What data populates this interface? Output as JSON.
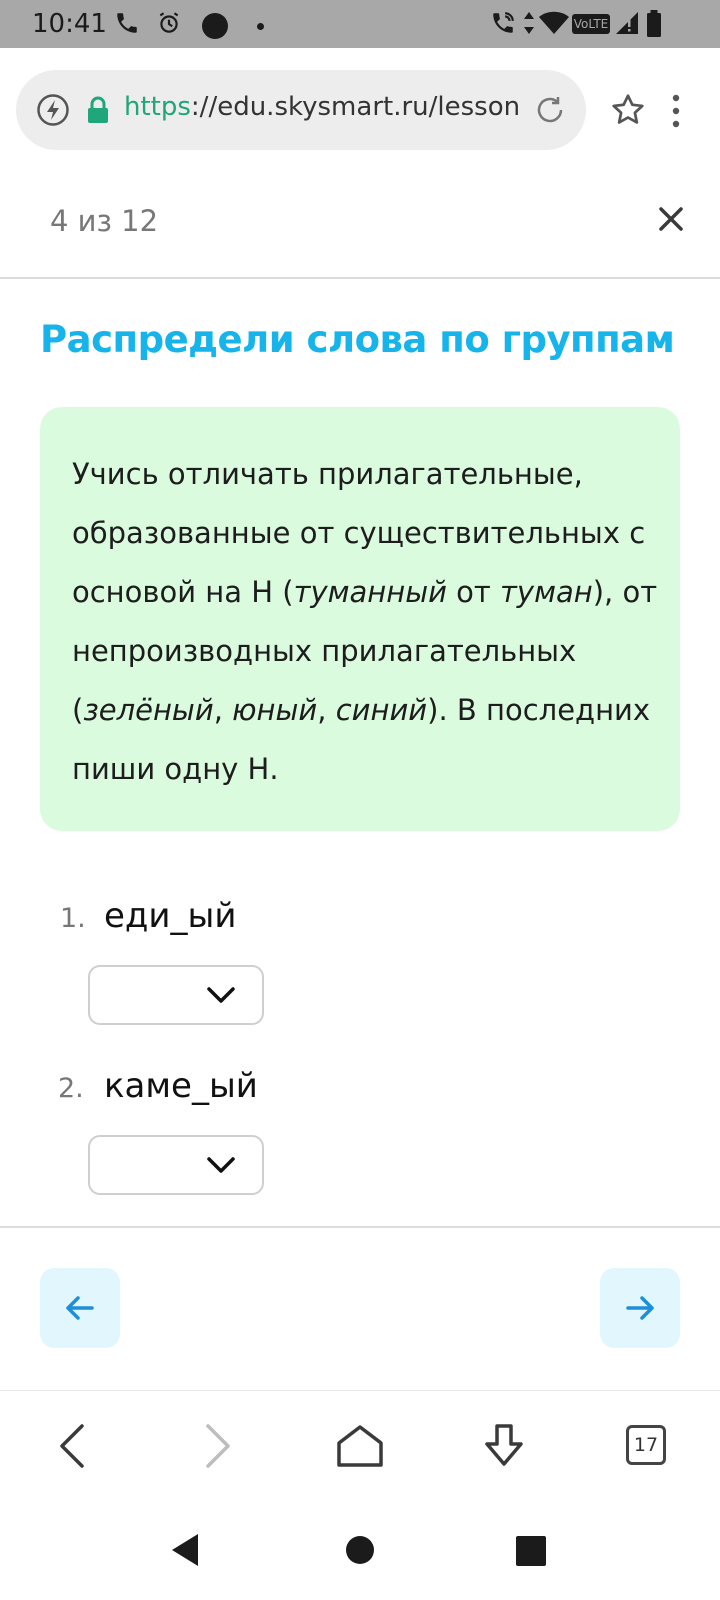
{
  "status_bar": {
    "time": "10:41",
    "icons": [
      "phone-icon",
      "alarm-icon",
      "record-dot-icon",
      "notification-dot-icon",
      "wifi-calling-icon",
      "data-arrows-icon",
      "wifi-icon",
      "volte-icon",
      "signal-icon",
      "battery-icon"
    ],
    "volte_label": "VoLTE"
  },
  "browser": {
    "url_scheme": "https",
    "url_rest": "://edu.skysmart.ru/lesson",
    "tab_count": "17"
  },
  "lesson": {
    "progress": "4 из 12",
    "title": "Распредели слова по группам",
    "hint": {
      "p1": "Учись отличать прилагательные, образованные от существительных с основой на Н (",
      "e1": "туманный",
      "p2": " от ",
      "e2": "туман",
      "p3": "), от непроизводных прилагательных (",
      "e3": "зелёный",
      "p4": ", ",
      "e4": "юный",
      "p5": ", ",
      "e5": "синий",
      "p6": "). В последних пиши одну Н."
    },
    "items": [
      {
        "num": "1.",
        "word": "еди_ый",
        "selected": ""
      },
      {
        "num": "2.",
        "word": "каме_ый",
        "selected": ""
      }
    ]
  },
  "colors": {
    "accent": "#16b4ea",
    "hint_bg": "#dbfbdf",
    "nav_button_bg": "#e2f7fd",
    "url_scheme": "#1fa67a"
  }
}
